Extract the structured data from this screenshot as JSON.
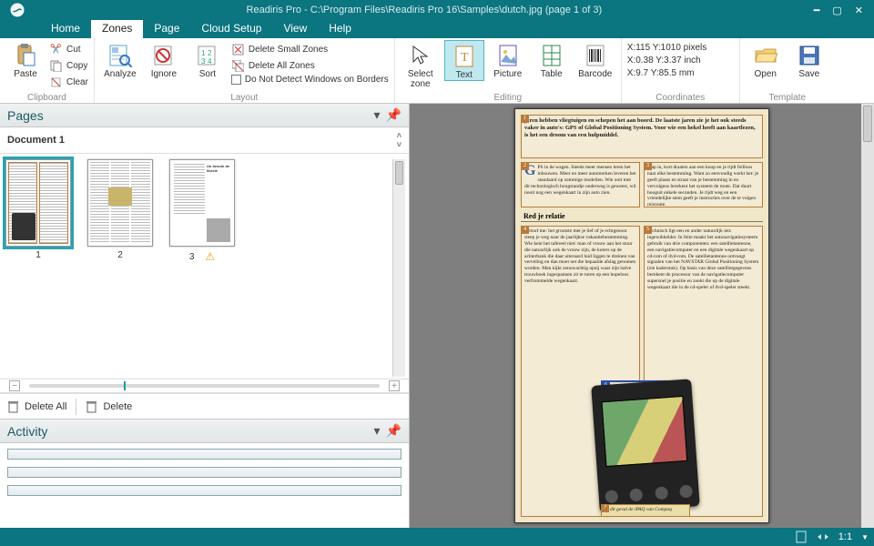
{
  "window": {
    "title": "Readiris Pro - C:\\Program Files\\Readiris Pro 16\\Samples\\dutch.jpg (page 1 of 3)"
  },
  "tabs": {
    "home": "Home",
    "zones": "Zones",
    "page": "Page",
    "cloud": "Cloud Setup",
    "view": "View",
    "help": "Help"
  },
  "ribbon": {
    "clipboard": {
      "paste": "Paste",
      "cut": "Cut",
      "copy": "Copy",
      "clear": "Clear",
      "label": "Clipboard"
    },
    "layout": {
      "analyze": "Analyze",
      "ignore": "Ignore",
      "sort": "Sort",
      "del_small": "Delete Small Zones",
      "del_all": "Delete All Zones",
      "no_detect": "Do Not Detect Windows on Borders",
      "label": "Layout"
    },
    "editing": {
      "select": "Select zone",
      "text": "Text",
      "picture": "Picture",
      "table": "Table",
      "barcode": "Barcode",
      "label": "Editing"
    },
    "coords": {
      "line1": "X:115  Y:1010 pixels",
      "line2": "X:0.38  Y:3.37 inch",
      "line3": "X:9.7  Y:85.5 mm",
      "label": "Coordinates"
    },
    "template": {
      "open": "Open",
      "save": "Save",
      "label": "Template"
    }
  },
  "pages": {
    "title": "Pages",
    "doc": "Document 1",
    "nums": {
      "p1": "1",
      "p2": "2",
      "p3": "3"
    },
    "delete_all": "Delete All",
    "delete": "Delete"
  },
  "activity": {
    "title": "Activity"
  },
  "status": {
    "ratio": "1:1"
  },
  "scan": {
    "headline": "jaren hebben vliegtuigen en schepen het aan boord. De laatste jaren zie je het ook steeds vaker in auto's: GPS of Global Positioning System. Voor wie een hekel heeft aan kaartlezen, is het een droom van een hulpmiddel.",
    "relatie": "Red je relatie"
  }
}
